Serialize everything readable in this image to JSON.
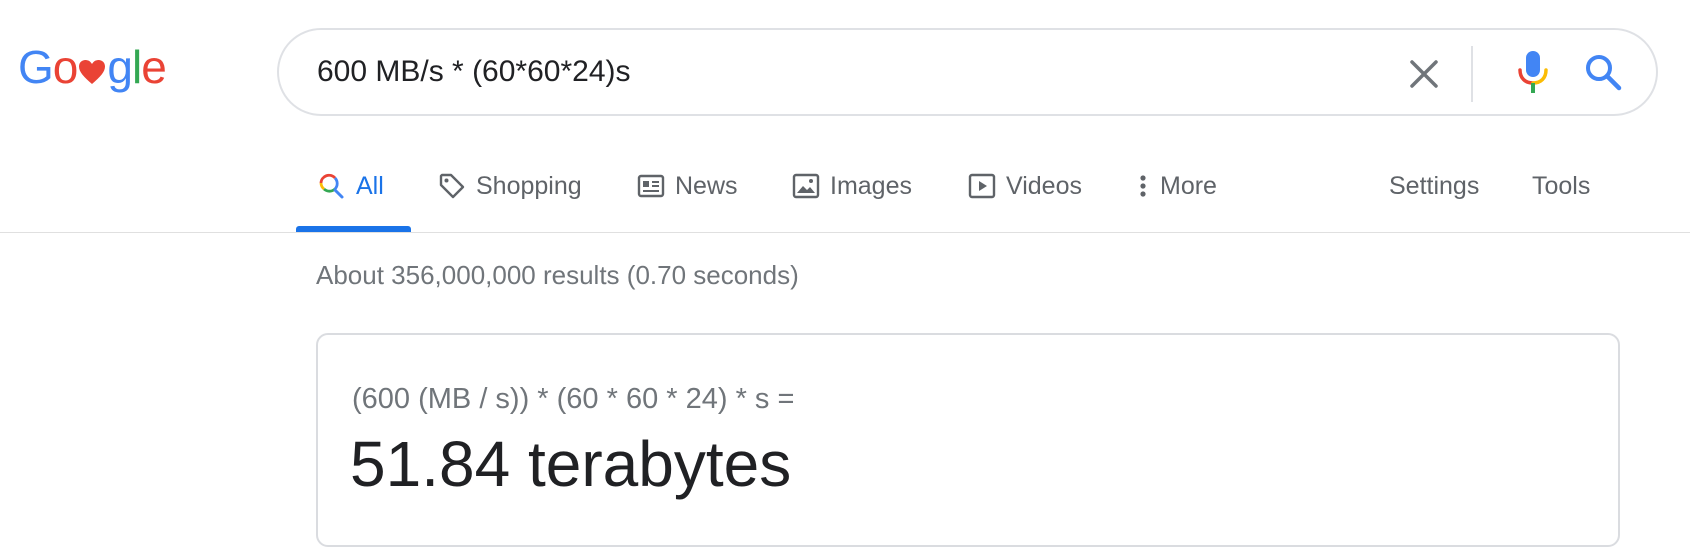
{
  "logo": {
    "letters_before": "Go",
    "letters_after": "gle"
  },
  "search": {
    "query": "600 MB/s * (60*60*24)s"
  },
  "tabs": [
    {
      "label": "All",
      "icon": "search-icon"
    },
    {
      "label": "Shopping",
      "icon": "tag-icon"
    },
    {
      "label": "News",
      "icon": "newspaper-icon"
    },
    {
      "label": "Images",
      "icon": "image-icon"
    },
    {
      "label": "Videos",
      "icon": "play-icon"
    },
    {
      "label": "More",
      "icon": "more-vert-icon"
    }
  ],
  "tools": {
    "settings": "Settings",
    "tools": "Tools"
  },
  "result_stats": "About 356,000,000 results (0.70 seconds)",
  "calculator": {
    "expression": "(600 (MB / s)) * (60 * 60 * 24) * s =",
    "result": "51.84 terabytes"
  },
  "colors": {
    "blue": "#4285f4",
    "red": "#ea4335",
    "yellow": "#fbbc05",
    "green": "#34a853",
    "active_tab": "#1a73e8"
  }
}
